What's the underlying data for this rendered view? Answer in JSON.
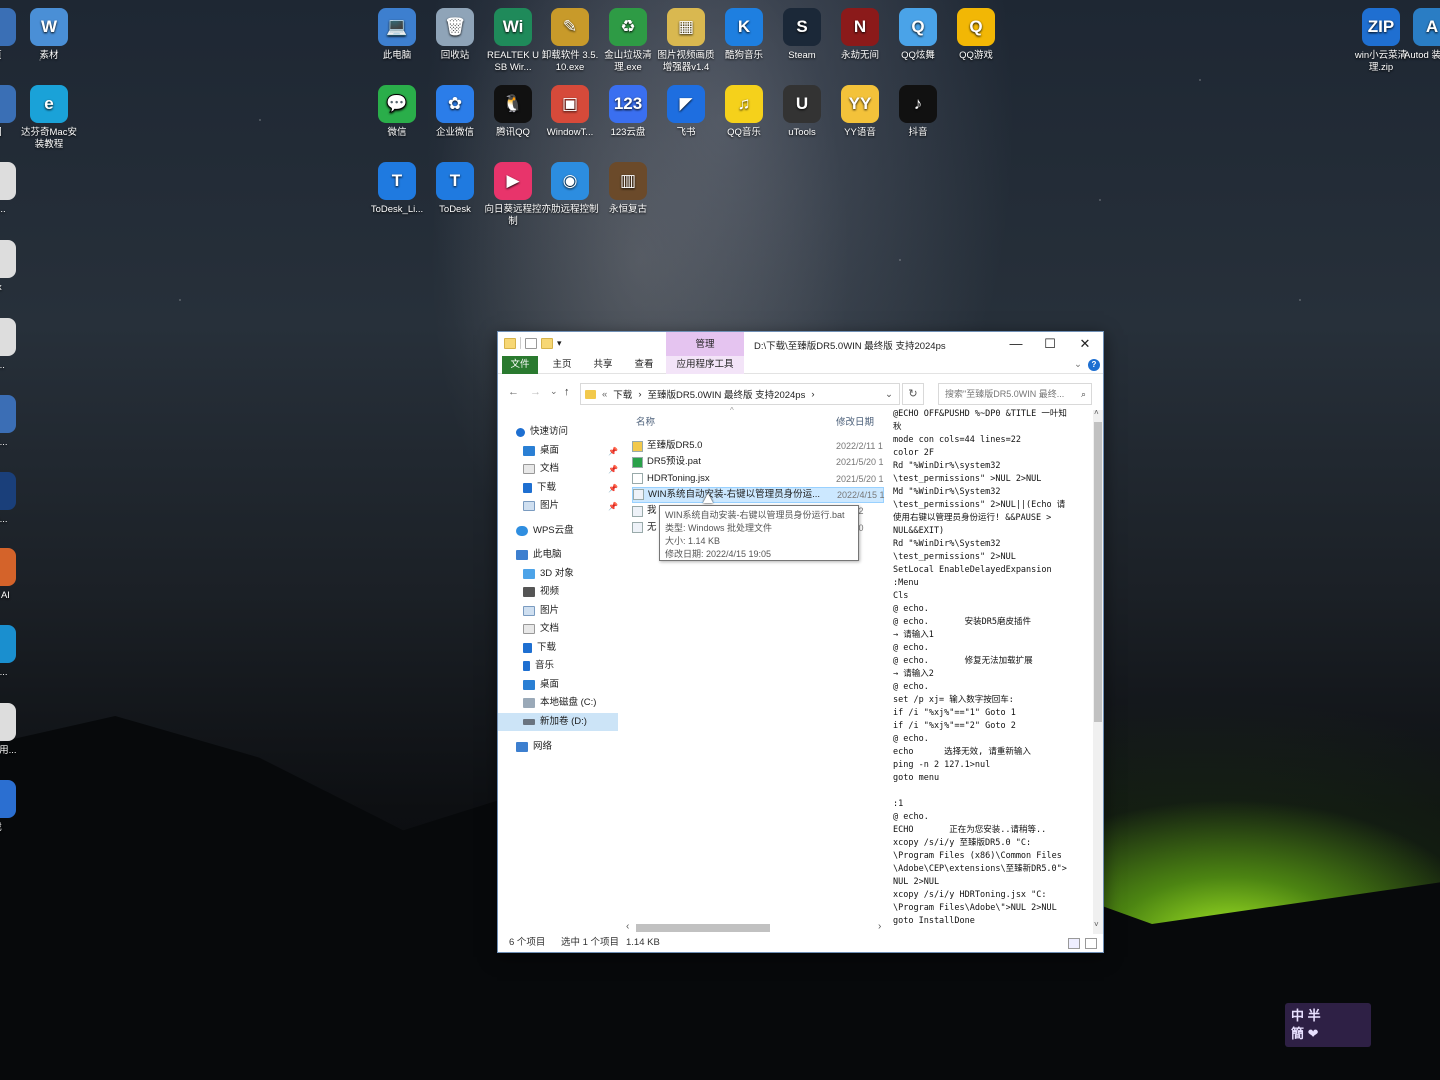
{
  "desktop": {
    "icons": [
      {
        "label": "页",
        "color": "#3a6fb5",
        "glyph": "",
        "name": "edge-page-icon"
      },
      {
        "label": "素材",
        "color": "#4a8fd6",
        "glyph": "W",
        "name": "word-doc-icon"
      },
      {
        "label": "此电脑",
        "color": "#3d7fcf",
        "glyph": "💻",
        "name": "this-pc-icon"
      },
      {
        "label": "回收站",
        "color": "#8fa4b8",
        "glyph": "🗑",
        "name": "recycle-bin-icon"
      },
      {
        "label": "REALTEK USB Wir...",
        "color": "#1f8a5a",
        "glyph": "Wi",
        "name": "realtek-icon"
      },
      {
        "label": "卸载软件 3.5.10.exe",
        "color": "#c89a2a",
        "glyph": "✎",
        "name": "uninstall-icon"
      },
      {
        "label": "金山垃圾清理.exe",
        "color": "#2e9b45",
        "glyph": "♻",
        "name": "kingsoft-clean-icon"
      },
      {
        "label": "图片视频画质增强器v1.4",
        "color": "#d9b850",
        "glyph": "▦",
        "name": "image-enhancer-icon"
      },
      {
        "label": "酷狗音乐",
        "color": "#1e7fe0",
        "glyph": "K",
        "name": "kugou-icon"
      },
      {
        "label": "Steam",
        "color": "#1b2838",
        "glyph": "S",
        "name": "steam-icon"
      },
      {
        "label": "永劫无间",
        "color": "#8b1a1a",
        "glyph": "N",
        "name": "naraka-icon"
      },
      {
        "label": "QQ炫舞",
        "color": "#4aa3e8",
        "glyph": "Q",
        "name": "qq-dance-icon"
      },
      {
        "label": "QQ游戏",
        "color": "#f2b705",
        "glyph": "Q",
        "name": "qq-game-icon"
      },
      {
        "label": "win小云菜清理.zip",
        "color": "#1f6fd1",
        "glyph": "ZIP",
        "name": "zip-icon"
      },
      {
        "label": "Autod 装重启",
        "color": "#2a7dc4",
        "glyph": "A",
        "name": "autodesk-icon"
      },
      {
        "label": "图",
        "color": "#3a6fb5",
        "glyph": "",
        "name": "left-icon-2"
      },
      {
        "label": "达芬奇Mac安装教程",
        "color": "#1aa2d8",
        "glyph": "e",
        "name": "edge-mac-tutorial-icon"
      },
      {
        "label": "微信",
        "color": "#2aae4a",
        "glyph": "💬",
        "name": "wechat-icon"
      },
      {
        "label": "企业微信",
        "color": "#2b7de9",
        "glyph": "✿",
        "name": "wecom-icon"
      },
      {
        "label": "腾讯QQ",
        "color": "#111111",
        "glyph": "🐧",
        "name": "qq-icon"
      },
      {
        "label": "WindowT...",
        "color": "#d64a3a",
        "glyph": "▣",
        "name": "windowtop-icon"
      },
      {
        "label": "123云盘",
        "color": "#3a6ff0",
        "glyph": "123",
        "name": "123pan-icon"
      },
      {
        "label": "飞书",
        "color": "#1e6ee0",
        "glyph": "◤",
        "name": "feishu-icon"
      },
      {
        "label": "QQ音乐",
        "color": "#f5d11b",
        "glyph": "♫",
        "name": "qq-music-icon"
      },
      {
        "label": "uTools",
        "color": "#333333",
        "glyph": "U",
        "name": "utools-icon"
      },
      {
        "label": "YY语音",
        "color": "#f3c23a",
        "glyph": "YY",
        "name": "yy-icon"
      },
      {
        "label": "抖音",
        "color": "#111111",
        "glyph": "♪",
        "name": "douyin-icon"
      },
      {
        "label": "接...",
        "color": "#dddddd",
        "glyph": "",
        "name": "left-icon-3"
      },
      {
        "label": "ToDesk_Li...",
        "color": "#1f7ae0",
        "glyph": "T",
        "name": "todesk-lite-icon"
      },
      {
        "label": "ToDesk",
        "color": "#1f7ae0",
        "glyph": "T",
        "name": "todesk-icon"
      },
      {
        "label": "向日葵远程控制",
        "color": "#e8346b",
        "glyph": "▶",
        "name": "sunlogin-icon"
      },
      {
        "label": "亦肋远程控制",
        "color": "#2c8de0",
        "glyph": "◉",
        "name": "yileng-remote-icon"
      },
      {
        "label": "永恒复古",
        "color": "#6b4a2a",
        "glyph": "▥",
        "name": "eternal-retro-icon"
      },
      {
        "label": "sx",
        "color": "#dddddd",
        "glyph": "",
        "name": "left-icon-4"
      },
      {
        "label": "of...",
        "color": "#dddddd",
        "glyph": "",
        "name": "left-icon-5"
      },
      {
        "label": "n 4...",
        "color": "#3b6eb5",
        "glyph": "",
        "name": "left-icon-6"
      },
      {
        "label": "e h...",
        "color": "#1a3f7a",
        "glyph": "",
        "name": "left-icon-7"
      },
      {
        "label": "z el AI",
        "color": "#d4632a",
        "glyph": "",
        "name": "left-icon-8"
      },
      {
        "label": "e h...",
        "color": "#1a8fcf",
        "glyph": "",
        "name": "left-icon-9"
      },
      {
        "label": "常见 用...",
        "color": "#dddddd",
        "glyph": "",
        "name": "left-icon-10"
      },
      {
        "label": "裁",
        "color": "#2b6fd1",
        "glyph": "",
        "name": "left-icon-11"
      }
    ],
    "watermark": "中 半\n簡 ❤"
  },
  "window": {
    "quick_access_more": "▾",
    "manage_tab": "管理",
    "title": "D:\\下载\\至臻版DR5.0WIN 最终版 支持2024ps",
    "minimize": "—",
    "maximize": "☐",
    "close": "✕",
    "ribbon_tabs": {
      "file": "文件",
      "home": "主页",
      "share": "共享",
      "view": "查看",
      "app_tools": "应用程序工具"
    },
    "ribbon_expand": "⌄",
    "help": "?",
    "nav": {
      "back": "←",
      "forward": "→",
      "recent": "⌄",
      "up": "↑"
    },
    "address": {
      "prefix": "«",
      "crumb1": "下载",
      "sep": "›",
      "crumb2": "至臻版DR5.0WIN 最终版 支持2024ps",
      "sep2": "›",
      "dropdown": "⌄"
    },
    "refresh": "↻",
    "search_placeholder": "搜索\"至臻版DR5.0WIN 最终...",
    "search_icon": "⌕",
    "navpane": {
      "quick_access": "快速访问",
      "desktop": "桌面",
      "documents": "文档",
      "downloads": "下载",
      "pictures": "图片",
      "wps": "WPS云盘",
      "this_pc": "此电脑",
      "objects3d": "3D 对象",
      "videos": "视频",
      "pictures2": "图片",
      "documents2": "文档",
      "downloads2": "下载",
      "music": "音乐",
      "desktop2": "桌面",
      "local_c": "本地磁盘 (C:)",
      "new_d": "新加卷 (D:)",
      "network": "网络",
      "pin": "📌"
    },
    "columns": {
      "name": "名称",
      "date": "修改日期",
      "sort_arrow": "^"
    },
    "files": [
      {
        "name": "至臻版DR5.0",
        "date": "2022/2/11 1",
        "type": "folder"
      },
      {
        "name": "DR5预设.pat",
        "date": "2021/5/20 1",
        "type": "pat"
      },
      {
        "name": "HDRToning.jsx",
        "date": "2021/5/20 1",
        "type": "file"
      },
      {
        "name": "WIN系统自动安装-右键以管理员身份运...",
        "date": "2022/4/15 1",
        "type": "bat"
      },
      {
        "name": "我",
        "date": "/7/26 2",
        "type": "bat"
      },
      {
        "name": "无",
        "date": "/3/1 20",
        "type": "bat"
      }
    ],
    "tooltip": {
      "name": "WIN系统自动安装-右键以管理员身份运行.bat",
      "type": "类型: Windows 批处理文件",
      "size": "大小: 1.14 KB",
      "modified": "修改日期: 2022/4/15 19:05"
    },
    "preview_text": "@ECHO OFF&PUSHD %~DP0 &TITLE 一叶知\n秋\nmode con cols=44 lines=22\ncolor 2F\nRd \"%WinDir%\\system32\n\\test_permissions\" >NUL 2>NUL\nMd \"%WinDir%\\System32\n\\test_permissions\" 2>NUL||(Echo 请\n使用右键以管理员身份运行! &&PAUSE >\nNUL&&EXIT)\nRd \"%WinDir%\\System32\n\\test_permissions\" 2>NUL\nSetLocal EnableDelayedExpansion\n:Menu\nCls\n@ echo.\n@ echo.       安装DR5磨皮插件\n→ 请输入1\n@ echo.\n@ echo.       修复无法加载扩展\n→ 请输入2\n@ echo.\nset /p xj= 输入数字按回车:\nif /i \"%xj%\"==\"1\" Goto 1\nif /i \"%xj%\"==\"2\" Goto 2\n@ echo.\necho      选择无效, 请重新输入\nping -n 2 127.1>nul\ngoto menu\n\n:1\n@ echo.\nECHO       正在为您安装..请稍等..\nxcopy /s/i/y 至臻版DR5.0 \"C:\n\\Program Files (x86)\\Common Files\n\\Adobe\\CEP\\extensions\\至臻新DR5.0\">\nNUL 2>NUL\nxcopy /s/i/y HDRToning.jsx \"C:\n\\Program Files\\Adobe\\\">NUL 2>NUL\ngoto InstallDone",
    "status": {
      "count": "6 个项目",
      "selected": "选中 1 个项目",
      "size": "1.14 KB"
    },
    "hscroll_left": "‹",
    "hscroll_right": "›",
    "vscroll_up": "˄",
    "vscroll_down": "˅"
  }
}
